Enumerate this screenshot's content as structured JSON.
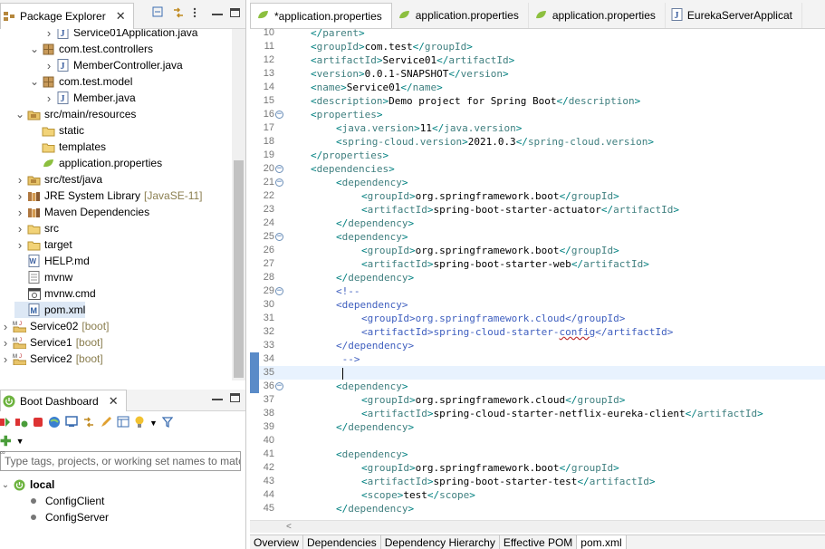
{
  "package_explorer": {
    "title": "Package Explorer",
    "tree": [
      {
        "label": "Service01Application.java",
        "icon": "java-file-icon",
        "indent": 3,
        "twisty": "collapsed"
      },
      {
        "label": "com.test.controllers",
        "icon": "package-icon",
        "indent": 2,
        "twisty": "expanded"
      },
      {
        "label": "MemberController.java",
        "icon": "java-file-icon",
        "indent": 3,
        "twisty": "collapsed"
      },
      {
        "label": "com.test.model",
        "icon": "package-icon",
        "indent": 2,
        "twisty": "expanded"
      },
      {
        "label": "Member.java",
        "icon": "java-file-icon",
        "indent": 3,
        "twisty": "collapsed"
      },
      {
        "label": "src/main/resources",
        "icon": "source-folder-icon",
        "indent": 1,
        "twisty": "expanded"
      },
      {
        "label": "static",
        "icon": "folder-icon",
        "indent": 2,
        "twisty": "none"
      },
      {
        "label": "templates",
        "icon": "folder-icon",
        "indent": 2,
        "twisty": "none"
      },
      {
        "label": "application.properties",
        "icon": "spring-leaf-icon",
        "indent": 2,
        "twisty": "none"
      },
      {
        "label": "src/test/java",
        "icon": "source-folder-icon",
        "indent": 1,
        "twisty": "collapsed"
      },
      {
        "label": "JRE System Library",
        "decoration": "[JavaSE-11]",
        "icon": "library-icon",
        "indent": 1,
        "twisty": "collapsed"
      },
      {
        "label": "Maven Dependencies",
        "icon": "library-icon",
        "indent": 1,
        "twisty": "collapsed"
      },
      {
        "label": "src",
        "icon": "folder-icon",
        "indent": 1,
        "twisty": "collapsed"
      },
      {
        "label": "target",
        "icon": "folder-icon",
        "indent": 1,
        "twisty": "collapsed"
      },
      {
        "label": "HELP.md",
        "icon": "markdown-file-icon",
        "indent": 1,
        "twisty": "none"
      },
      {
        "label": "mvnw",
        "icon": "text-file-icon",
        "indent": 1,
        "twisty": "none"
      },
      {
        "label": "mvnw.cmd",
        "icon": "cmd-file-icon",
        "indent": 1,
        "twisty": "none"
      },
      {
        "label": "pom.xml",
        "icon": "xml-file-icon",
        "indent": 1,
        "twisty": "none",
        "selected": true
      },
      {
        "label": "Service02",
        "decoration": "[boot]",
        "icon": "maven-project-icon",
        "indent": 0,
        "twisty": "collapsed"
      },
      {
        "label": "Service1",
        "decoration": "[boot]",
        "icon": "maven-project-icon",
        "indent": 0,
        "twisty": "collapsed"
      },
      {
        "label": "Service2",
        "decoration": "[boot]",
        "icon": "maven-project-icon",
        "indent": 0,
        "twisty": "collapsed"
      }
    ]
  },
  "boot_dashboard": {
    "title": "Boot Dashboard",
    "search_placeholder": "Type tags, projects, or working set names to match",
    "group_label": "local",
    "apps": [
      "ConfigClient",
      "ConfigServer"
    ]
  },
  "editor": {
    "tabs": [
      {
        "label": "*application.properties",
        "icon": "spring-leaf-icon",
        "active": true
      },
      {
        "label": "application.properties",
        "icon": "spring-leaf-icon",
        "active": false
      },
      {
        "label": "application.properties",
        "icon": "spring-leaf-icon",
        "active": false
      },
      {
        "label": "EurekaServerApplicat",
        "icon": "java-file-icon",
        "active": false
      }
    ],
    "bottom_tabs": [
      "Overview",
      "Dependencies",
      "Dependency Hierarchy",
      "Effective POM",
      "pom.xml"
    ],
    "active_bottom_tab": "pom.xml",
    "current_line": 35,
    "lines": [
      {
        "n": 10,
        "fold": "",
        "indent": 1,
        "t": "close",
        "tag": "parent"
      },
      {
        "n": 11,
        "fold": "",
        "indent": 1,
        "t": "el",
        "tag": "groupId",
        "val": "com.test"
      },
      {
        "n": 12,
        "fold": "",
        "indent": 1,
        "t": "el",
        "tag": "artifactId",
        "val": "Service01"
      },
      {
        "n": 13,
        "fold": "",
        "indent": 1,
        "t": "el",
        "tag": "version",
        "val": "0.0.1-SNAPSHOT"
      },
      {
        "n": 14,
        "fold": "",
        "indent": 1,
        "t": "el",
        "tag": "name",
        "val": "Service01"
      },
      {
        "n": 15,
        "fold": "",
        "indent": 1,
        "t": "el",
        "tag": "description",
        "val": "Demo project for Spring Boot"
      },
      {
        "n": 16,
        "fold": "⊖",
        "indent": 1,
        "t": "open",
        "tag": "properties"
      },
      {
        "n": 17,
        "fold": "",
        "indent": 2,
        "t": "el",
        "tag": "java.version",
        "val": "11"
      },
      {
        "n": 18,
        "fold": "",
        "indent": 2,
        "t": "el",
        "tag": "spring-cloud.version",
        "val": "2021.0.3"
      },
      {
        "n": 19,
        "fold": "",
        "indent": 1,
        "t": "close",
        "tag": "properties"
      },
      {
        "n": 20,
        "fold": "⊖",
        "indent": 1,
        "t": "open",
        "tag": "dependencies"
      },
      {
        "n": 21,
        "fold": "⊖",
        "indent": 2,
        "t": "open",
        "tag": "dependency"
      },
      {
        "n": 22,
        "fold": "",
        "indent": 3,
        "t": "el",
        "tag": "groupId",
        "val": "org.springframework.boot"
      },
      {
        "n": 23,
        "fold": "",
        "indent": 3,
        "t": "el",
        "tag": "artifactId",
        "val": "spring-boot-starter-actuator"
      },
      {
        "n": 24,
        "fold": "",
        "indent": 2,
        "t": "close",
        "tag": "dependency"
      },
      {
        "n": 25,
        "fold": "⊖",
        "indent": 2,
        "t": "open",
        "tag": "dependency"
      },
      {
        "n": 26,
        "fold": "",
        "indent": 3,
        "t": "el",
        "tag": "groupId",
        "val": "org.springframework.boot"
      },
      {
        "n": 27,
        "fold": "",
        "indent": 3,
        "t": "el",
        "tag": "artifactId",
        "val": "spring-boot-starter-web"
      },
      {
        "n": 28,
        "fold": "",
        "indent": 2,
        "t": "close",
        "tag": "dependency"
      },
      {
        "n": 29,
        "fold": "⊖",
        "indent": 2,
        "t": "comment",
        "text": "<!--"
      },
      {
        "n": 30,
        "fold": "",
        "indent": 2,
        "t": "comment",
        "text": "<dependency>"
      },
      {
        "n": 31,
        "fold": "",
        "indent": 3,
        "t": "comment",
        "text": "<groupId>org.springframework.cloud</groupId>"
      },
      {
        "n": 32,
        "fold": "",
        "indent": 3,
        "t": "comment",
        "text": "<artifactId>spring-cloud-starter-config</artifactId>"
      },
      {
        "n": 33,
        "fold": "",
        "indent": 2,
        "t": "comment",
        "text": "</dependency>"
      },
      {
        "n": 34,
        "fold": "",
        "indent": 2,
        "t": "comment",
        "text": " -->"
      },
      {
        "n": 35,
        "fold": "",
        "indent": 2,
        "t": "caret",
        "text": " "
      },
      {
        "n": 36,
        "fold": "⊖",
        "indent": 2,
        "t": "open",
        "tag": "dependency"
      },
      {
        "n": 37,
        "fold": "",
        "indent": 3,
        "t": "el",
        "tag": "groupId",
        "val": "org.springframework.cloud"
      },
      {
        "n": 38,
        "fold": "",
        "indent": 3,
        "t": "el",
        "tag": "artifactId",
        "val": "spring-cloud-starter-netflix-eureka-client"
      },
      {
        "n": 39,
        "fold": "",
        "indent": 2,
        "t": "close",
        "tag": "dependency"
      },
      {
        "n": 40,
        "fold": "",
        "indent": 0,
        "t": "blank"
      },
      {
        "n": 41,
        "fold": "",
        "indent": 2,
        "t": "open",
        "tag": "dependency"
      },
      {
        "n": 42,
        "fold": "",
        "indent": 3,
        "t": "el",
        "tag": "groupId",
        "val": "org.springframework.boot"
      },
      {
        "n": 43,
        "fold": "",
        "indent": 3,
        "t": "el",
        "tag": "artifactId",
        "val": "spring-boot-starter-test"
      },
      {
        "n": 44,
        "fold": "",
        "indent": 3,
        "t": "el",
        "tag": "scope",
        "val": "test"
      },
      {
        "n": 45,
        "fold": "",
        "indent": 2,
        "t": "close",
        "tag": "dependency"
      }
    ]
  },
  "colors": {
    "tag": "#3f7f7f",
    "comment": "#3f5fbf",
    "selection": "#dde8f5",
    "current_line": "#e8f2fe",
    "spring_green": "#6db33f"
  }
}
